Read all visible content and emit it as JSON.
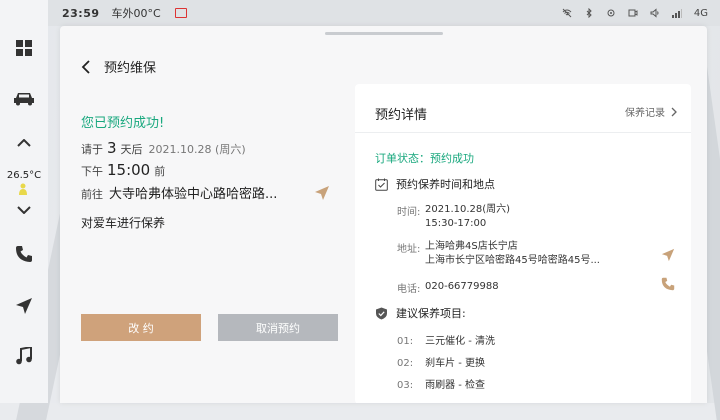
{
  "status_bar": {
    "time": "23:59",
    "outside_temp": "车外00°C",
    "signal": "4G",
    "colors": {
      "mail": "#d33333"
    }
  },
  "dock": {
    "cabin_temp": "26.5°C",
    "icons": [
      "grid-icon",
      "car-icon",
      "chevron-up-icon",
      "chevron-down-icon",
      "phone-icon",
      "navigation-icon",
      "music-icon"
    ]
  },
  "header": {
    "title": "预约维保"
  },
  "booking": {
    "success_text": "您已预约成功!",
    "please_label": "请于",
    "days_value": "3",
    "days_suffix": "天后",
    "date": "2021.10.28 (周六)",
    "period": "下午",
    "time": "15:00",
    "before": "前",
    "goto_label": "前往",
    "place": "大寺哈弗体验中心路哈密路...",
    "task": "对爱车进行保养"
  },
  "buttons": {
    "modify": "改 约",
    "cancel": "取消预约"
  },
  "details": {
    "title": "预约详情",
    "record_link": "保养记录",
    "order_status": "订单状态：预约成功",
    "time_place_section": "预约保养时间和地点",
    "time_label": "时间:",
    "time_date": "2021.10.28(周六)",
    "time_range": "15:30-17:00",
    "addr_label": "地址:",
    "addr_line1": "上海哈弗4S店长宁店",
    "addr_line2": "上海市长宁区哈密路45号哈密路45号...",
    "phone_label": "电话:",
    "phone": "020-66779988",
    "items_section": "建议保养项目:",
    "items": [
      {
        "no": "01:",
        "text": "三元催化 - 清洗"
      },
      {
        "no": "02:",
        "text": "刹车片 - 更换"
      },
      {
        "no": "03:",
        "text": "雨刷器 - 检查"
      }
    ]
  },
  "colors": {
    "accent_green": "#19a87e",
    "accent_gold": "#cfa27b",
    "nav_arrow": "#c8a27a"
  }
}
